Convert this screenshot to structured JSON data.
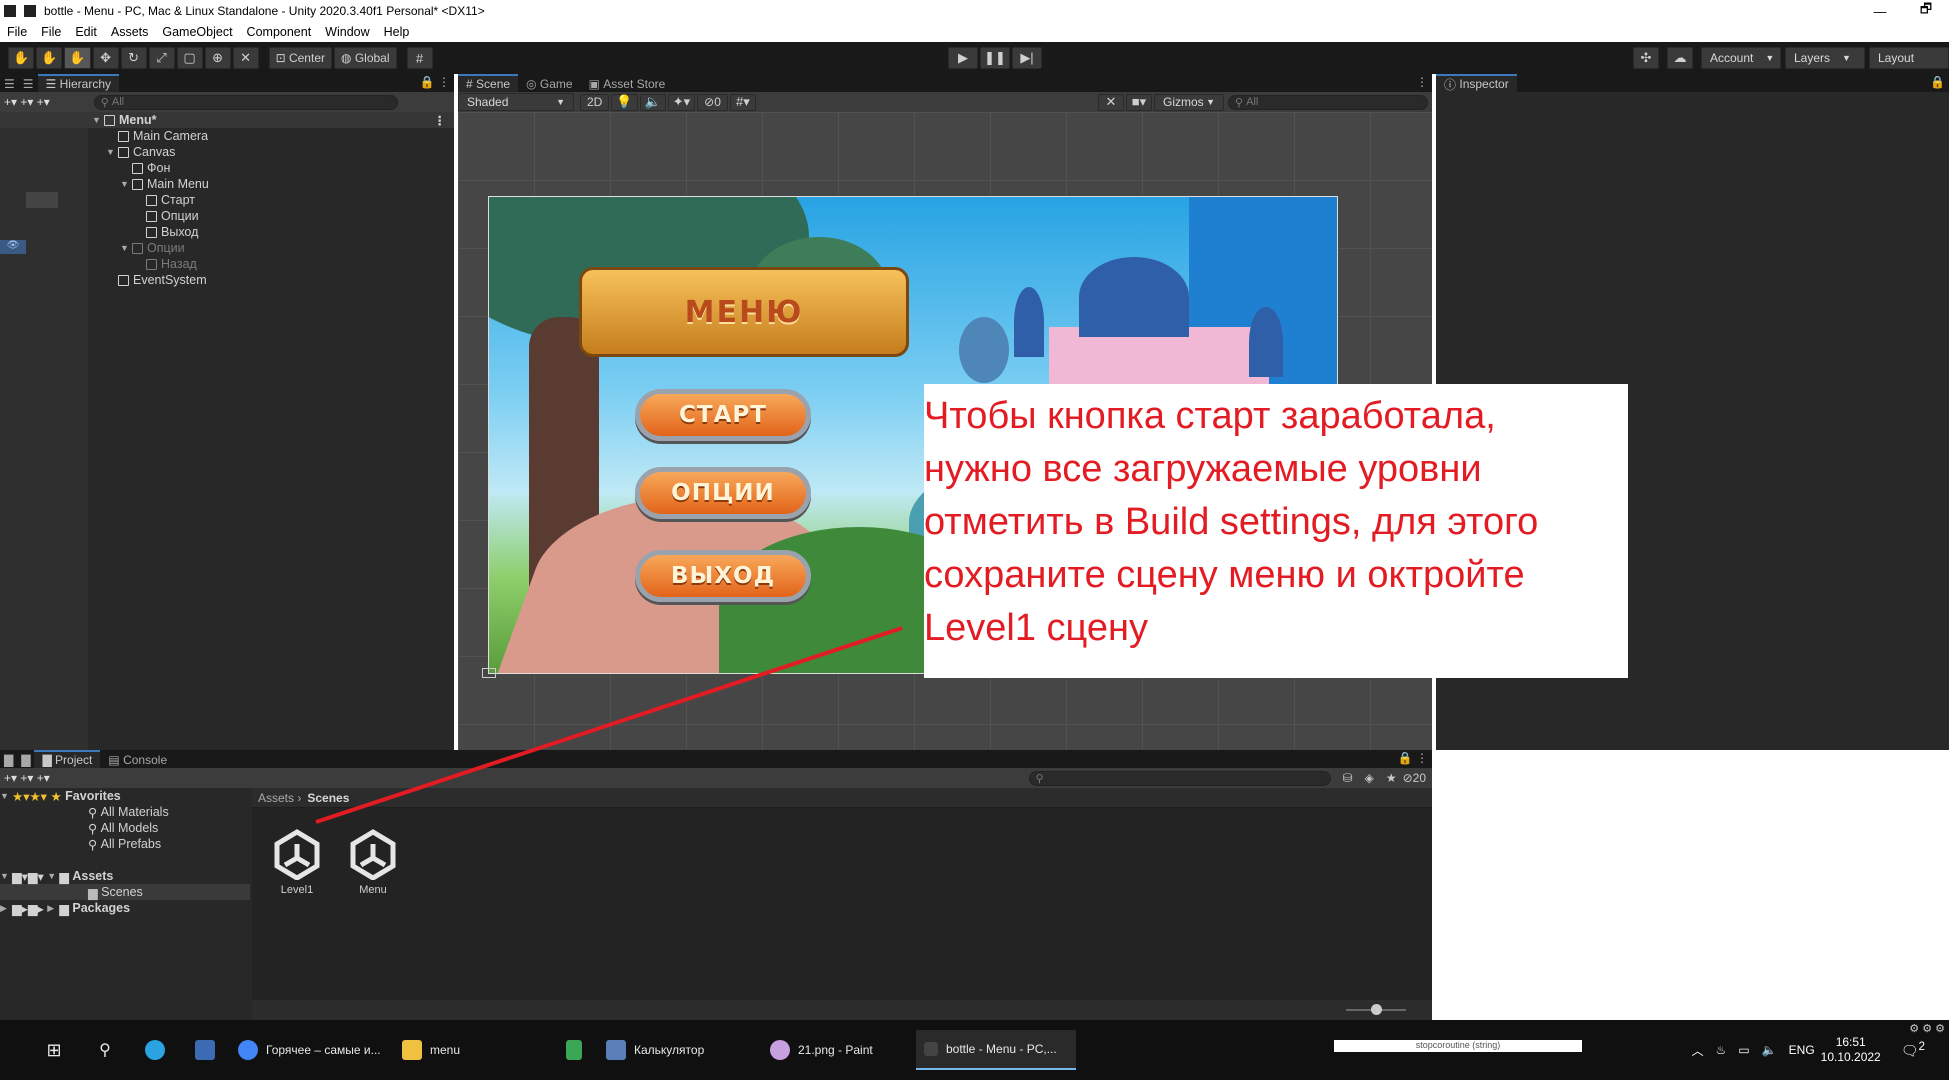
{
  "window": {
    "title": "bottle - Menu - PC, Mac & Linux Standalone - Unity 2020.3.40f1 Personal* <DX11>",
    "controls": [
      "—",
      "🗗"
    ]
  },
  "menubar": [
    "File",
    "File",
    "Edit",
    "Assets",
    "GameObject",
    "Component",
    "Window",
    "Help"
  ],
  "toolbar": {
    "pivot": "Center",
    "space": "Global",
    "account": "Account",
    "layers": "Layers",
    "layout": "Layout"
  },
  "hierarchy": {
    "tab": "Hierarchy",
    "search_placeholder": "All",
    "items": [
      {
        "label": "Menu*",
        "depth": 0,
        "type": "scene"
      },
      {
        "label": "Main Camera",
        "depth": 1
      },
      {
        "label": "Canvas",
        "depth": 1,
        "expanded": true
      },
      {
        "label": "Фон",
        "depth": 2
      },
      {
        "label": "Main Menu",
        "depth": 2,
        "expanded": true
      },
      {
        "label": "Старт",
        "depth": 3
      },
      {
        "label": "Опции",
        "depth": 3
      },
      {
        "label": "Выход",
        "depth": 3
      },
      {
        "label": "Опции",
        "depth": 2,
        "disabled": true,
        "expanded": true
      },
      {
        "label": "Назад",
        "depth": 3,
        "disabled": true
      },
      {
        "label": "EventSystem",
        "depth": 1
      }
    ]
  },
  "scene": {
    "tabs": [
      "Scene",
      "Game",
      "Asset Store"
    ],
    "shading": "Shaded",
    "mode_2d": "2D",
    "hidden_count": "0",
    "gizmos": "Gizmos",
    "search_placeholder": "All",
    "game": {
      "banner": "МЕНЮ",
      "buttons": [
        "СТАРТ",
        "ОПЦИИ",
        "ВЫХОД"
      ]
    }
  },
  "inspector": {
    "tab": "Inspector"
  },
  "project": {
    "tabs": [
      "Project",
      "Console"
    ],
    "favorites_label": "Favorites",
    "favorites": [
      "All Materials",
      "All Models",
      "All Prefabs"
    ],
    "assets_label": "Assets",
    "assets_children": [
      "Scenes"
    ],
    "packages_label": "Packages",
    "breadcrumb_root": "Assets",
    "breadcrumb_current": "Scenes",
    "visible_count": "20",
    "files": [
      "Level1",
      "Menu"
    ]
  },
  "annotation": {
    "lines": [
      "Чтобы кнопка старт заработала,",
      "нужно все загружаемые уровни",
      "отметить в Build settings, для этого",
      "сохраните сцену меню и октройте",
      "Level1 сцену"
    ],
    "color": "#e31b23"
  },
  "taskbar": {
    "items": [
      {
        "label": "Горячее – самые и...",
        "color": "#4285f4"
      },
      {
        "label": "menu",
        "color": "#f0c040"
      },
      {
        "label": "",
        "color": "#3aa757"
      },
      {
        "label": "Калькулятор",
        "color": "#5a7fb8"
      },
      {
        "label": "21.png - Paint",
        "color": "#c8a0e0"
      },
      {
        "label": "bottle - Menu - PC,...",
        "color": "#222222"
      }
    ],
    "lang": "ENG",
    "time": "16:51",
    "date": "10.10.2022",
    "notification_count": "2",
    "notification_snippet": "stopcoroutine (string)"
  }
}
